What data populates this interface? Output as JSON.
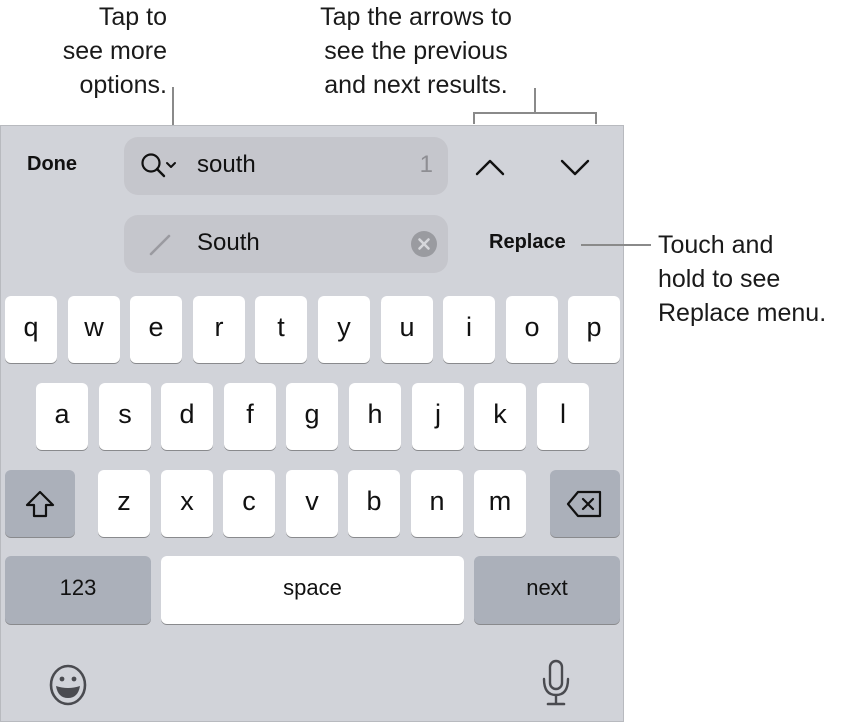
{
  "callouts": {
    "options": [
      "Tap to",
      "see more",
      "options."
    ],
    "arrows": [
      "Tap the arrows to",
      "see the previous",
      "and next results."
    ],
    "replace": [
      "Touch and",
      "hold to see",
      "Replace menu."
    ]
  },
  "toolbar": {
    "done_label": "Done",
    "search_value": "south",
    "match_count": "1",
    "replace_value": "South",
    "replace_label": "Replace",
    "icons": {
      "search": "magnifier-with-chevron-icon",
      "previous": "chevron-up-icon",
      "next": "chevron-down-icon",
      "pencil": "pencil-icon",
      "clear": "clear-circle-x-icon"
    }
  },
  "keyboard": {
    "row1": [
      "q",
      "w",
      "e",
      "r",
      "t",
      "y",
      "u",
      "i",
      "o",
      "p"
    ],
    "row2": [
      "a",
      "s",
      "d",
      "f",
      "g",
      "h",
      "j",
      "k",
      "l"
    ],
    "row3": [
      "z",
      "x",
      "c",
      "v",
      "b",
      "n",
      "m"
    ],
    "shift_icon": "shift-arrow-icon",
    "delete_icon": "delete-backspace-icon",
    "numbers_label": "123",
    "space_label": "space",
    "return_label": "next",
    "emoji_icon": "emoji-smiley-icon",
    "mic_icon": "microphone-icon"
  },
  "colors": {
    "keyboard_bg": "#d1d3d9",
    "key_bg": "#ffffff",
    "special_key_bg": "#abb0ba",
    "field_bg": "#c5c6cc",
    "callout_line": "#8a8a8a"
  }
}
